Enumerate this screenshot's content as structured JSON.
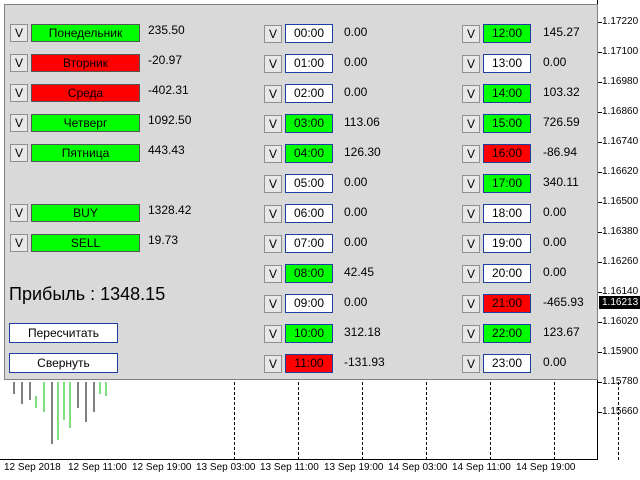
{
  "days": [
    {
      "label": "Понедельник",
      "value": "235.50",
      "color": "green"
    },
    {
      "label": "Вторник",
      "value": "-20.97",
      "color": "red"
    },
    {
      "label": "Среда",
      "value": "-402.31",
      "color": "red"
    },
    {
      "label": "Четверг",
      "value": "1092.50",
      "color": "green"
    },
    {
      "label": "Пятница",
      "value": "443.43",
      "color": "green"
    }
  ],
  "directions": [
    {
      "label": "BUY",
      "value": "1328.42",
      "color": "green"
    },
    {
      "label": "SELL",
      "value": "19.73",
      "color": "green"
    }
  ],
  "hours": [
    {
      "label": "00:00",
      "value": "0.00",
      "color": "white"
    },
    {
      "label": "01:00",
      "value": "0.00",
      "color": "white"
    },
    {
      "label": "02:00",
      "value": "0.00",
      "color": "white"
    },
    {
      "label": "03:00",
      "value": "113.06",
      "color": "green"
    },
    {
      "label": "04:00",
      "value": "126.30",
      "color": "green"
    },
    {
      "label": "05:00",
      "value": "0.00",
      "color": "white"
    },
    {
      "label": "06:00",
      "value": "0.00",
      "color": "white"
    },
    {
      "label": "07:00",
      "value": "0.00",
      "color": "white"
    },
    {
      "label": "08:00",
      "value": "42.45",
      "color": "green"
    },
    {
      "label": "09:00",
      "value": "0.00",
      "color": "white"
    },
    {
      "label": "10:00",
      "value": "312.18",
      "color": "green"
    },
    {
      "label": "11:00",
      "value": "-131.93",
      "color": "red"
    },
    {
      "label": "12:00",
      "value": "145.27",
      "color": "green"
    },
    {
      "label": "13:00",
      "value": "0.00",
      "color": "white"
    },
    {
      "label": "14:00",
      "value": "103.32",
      "color": "green"
    },
    {
      "label": "15:00",
      "value": "726.59",
      "color": "green"
    },
    {
      "label": "16:00",
      "value": "-86.94",
      "color": "red"
    },
    {
      "label": "17:00",
      "value": "340.11",
      "color": "green"
    },
    {
      "label": "18:00",
      "value": "0.00",
      "color": "white"
    },
    {
      "label": "19:00",
      "value": "0.00",
      "color": "white"
    },
    {
      "label": "20:00",
      "value": "0.00",
      "color": "white"
    },
    {
      "label": "21:00",
      "value": "-465.93",
      "color": "red"
    },
    {
      "label": "22:00",
      "value": "123.67",
      "color": "green"
    },
    {
      "label": "23:00",
      "value": "0.00",
      "color": "white"
    }
  ],
  "toggle_label": "V",
  "profit": {
    "text": "Прибыль : 1348.15"
  },
  "buttons": {
    "recalc": "Пересчитать",
    "collapse": "Свернуть"
  },
  "price_axis": [
    "1.17220",
    "1.17100",
    "1.16980",
    "1.16860",
    "1.16740",
    "1.16620",
    "1.16500",
    "1.16380",
    "1.16260",
    "1.16140",
    "1.16020",
    "1.15900",
    "1.15780",
    "1.15660"
  ],
  "current_price": "1.16213",
  "time_axis": [
    "12 Sep 2018",
    "12 Sep 11:00",
    "12 Sep 19:00",
    "13 Sep 03:00",
    "13 Sep 11:00",
    "13 Sep 19:00",
    "14 Sep 03:00",
    "14 Sep 11:00",
    "14 Sep 19:00"
  ],
  "colors": {
    "green": "#00ff00",
    "red": "#ff0000",
    "white": "#ffffff",
    "panel": "#d9d9d9",
    "bull": "#00c000",
    "bear": "#000000"
  }
}
